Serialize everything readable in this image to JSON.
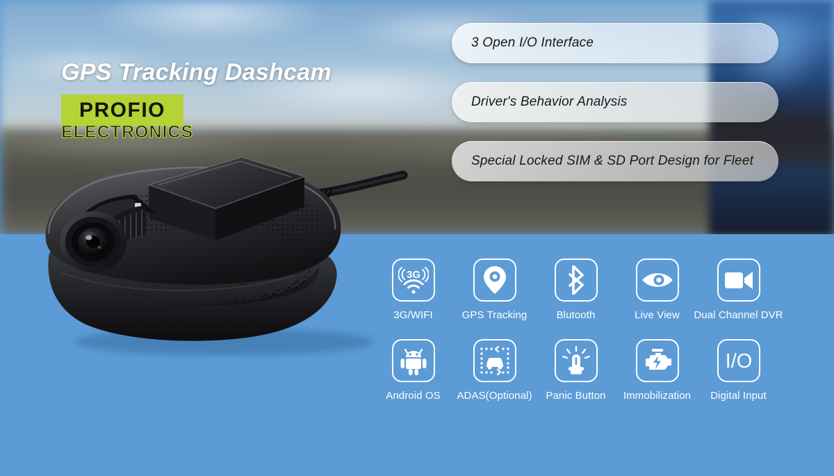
{
  "banner": {
    "headline": "GPS Tracking Dashcam",
    "brand": {
      "name": "PROFIO",
      "subtitle": "ELECTRONICS",
      "box_color": "#b5d334",
      "text_color": "#14140f"
    },
    "background": {
      "accent_blue": "#5c9bd6",
      "photo_description": "blurred desert highway with sky",
      "vehicle": "blue truck"
    }
  },
  "features": [
    {
      "label": "3 Open I/O Interface"
    },
    {
      "label": "Driver's Behavior Analysis"
    },
    {
      "label": "Special Locked SIM & SD Port Design for Fleet"
    }
  ],
  "specs": [
    {
      "label": "3G/WIFI",
      "icon": "3g-wifi-icon"
    },
    {
      "label": "GPS Tracking",
      "icon": "map-pin-icon"
    },
    {
      "label": "Blutooth",
      "icon": "bluetooth-icon"
    },
    {
      "label": "Live View",
      "icon": "eye-icon"
    },
    {
      "label": "Dual Channel DVR",
      "icon": "video-camera-icon"
    },
    {
      "label": "Android OS",
      "icon": "android-robot-icon"
    },
    {
      "label": "ADAS(Optional)",
      "icon": "adas-car-icon"
    },
    {
      "label": "Panic Button",
      "icon": "siren-alarm-icon"
    },
    {
      "label": "Immobilization",
      "icon": "engine-bolt-icon"
    },
    {
      "label": "Digital Input",
      "icon": "io-text-icon"
    }
  ],
  "product": {
    "name": "GPS Tracking Dashcam",
    "color": "black"
  }
}
